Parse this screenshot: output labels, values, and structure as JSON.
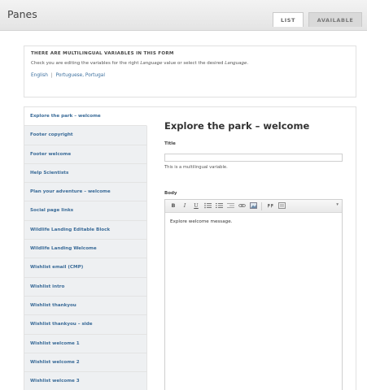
{
  "header": {
    "title": "Panes",
    "tabs": [
      {
        "label": "LIST",
        "active": true
      },
      {
        "label": "AVAILABLE",
        "active": false
      }
    ]
  },
  "notice": {
    "heading": "THERE ARE MULTILINGUAL VARIABLES IN THIS FORM",
    "desc_pre": "Check you are editing the variables for the right ",
    "desc_lang1": "Language",
    "desc_mid": " value or select the desired ",
    "desc_lang2": "Language",
    "desc_end": ".",
    "languages": [
      "English",
      "Portuguese, Portugal"
    ],
    "separator": "|"
  },
  "sidebar": {
    "items": [
      {
        "label": "Explore the park – welcome",
        "active": true
      },
      {
        "label": "Footer copyright",
        "active": false
      },
      {
        "label": "Footer welcome",
        "active": false
      },
      {
        "label": "Help Scientists",
        "active": false
      },
      {
        "label": "Plan your adventure – welcome",
        "active": false
      },
      {
        "label": "Social page links",
        "active": false
      },
      {
        "label": "Wildlife Landing Editable Block",
        "active": false
      },
      {
        "label": "Wildlife Landing Welcome",
        "active": false
      },
      {
        "label": "Wishlist email (CMP)",
        "active": false
      },
      {
        "label": "Wishlist intro",
        "active": false
      },
      {
        "label": "Wishlist thankyou",
        "active": false
      },
      {
        "label": "Wishlist thankyou – side",
        "active": false
      },
      {
        "label": "Wishlist welcome 1",
        "active": false
      },
      {
        "label": "Wishlist welcome 2",
        "active": false
      },
      {
        "label": "Wishlist welcome 3",
        "active": false
      }
    ]
  },
  "content": {
    "pane_title": "Explore the park – welcome",
    "title_label": "Title",
    "title_value": "",
    "title_hint": "This is a multilingual variable.",
    "body_label": "Body",
    "body_text": "Explore welcome message.",
    "toolbar": {
      "bold": "B",
      "italic": "I",
      "underline": "U",
      "more": "▾"
    }
  },
  "colors": {
    "link": "#3a6b98",
    "sidebar_bg": "#eef0f2"
  }
}
